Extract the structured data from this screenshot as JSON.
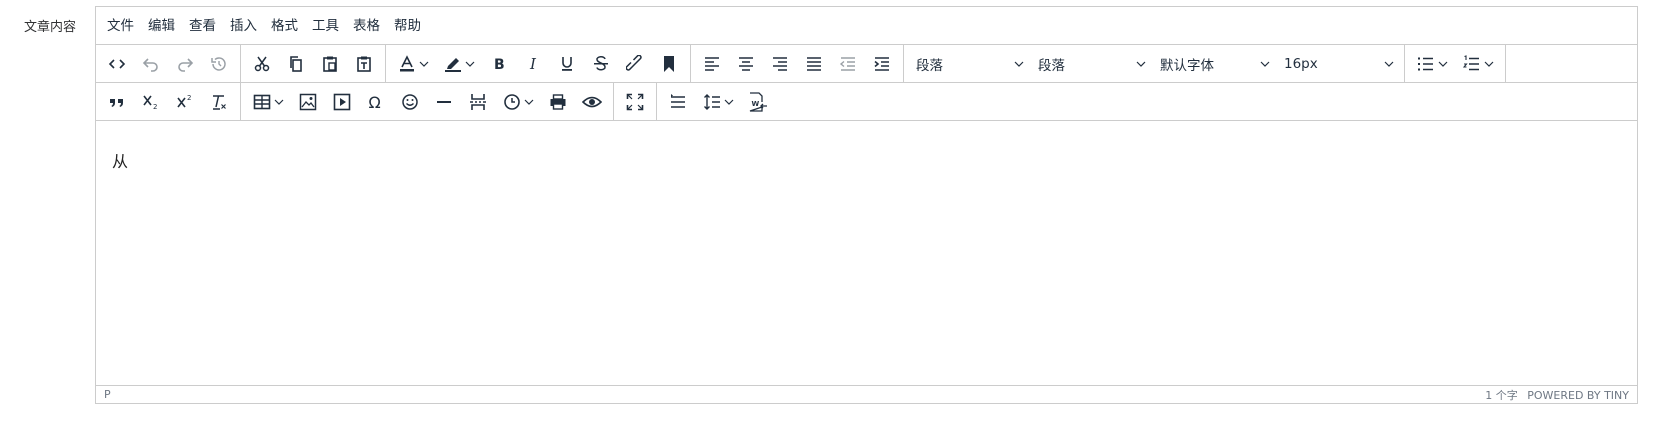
{
  "field_label": "文章内容",
  "menubar": [
    "文件",
    "编辑",
    "查看",
    "插入",
    "格式",
    "工具",
    "表格",
    "帮助"
  ],
  "toolbar": {
    "block_format": "段落",
    "block_format2": "段落",
    "font_family": "默认字体",
    "font_size": "16px"
  },
  "content": {
    "text": "从"
  },
  "statusbar": {
    "path": "P",
    "word_count": "1 个字",
    "branding": "POWERED BY TINY"
  },
  "colors": {
    "icon": "#222f3e",
    "disabled_icon": "#9aa0a6",
    "border": "#cccccc"
  }
}
